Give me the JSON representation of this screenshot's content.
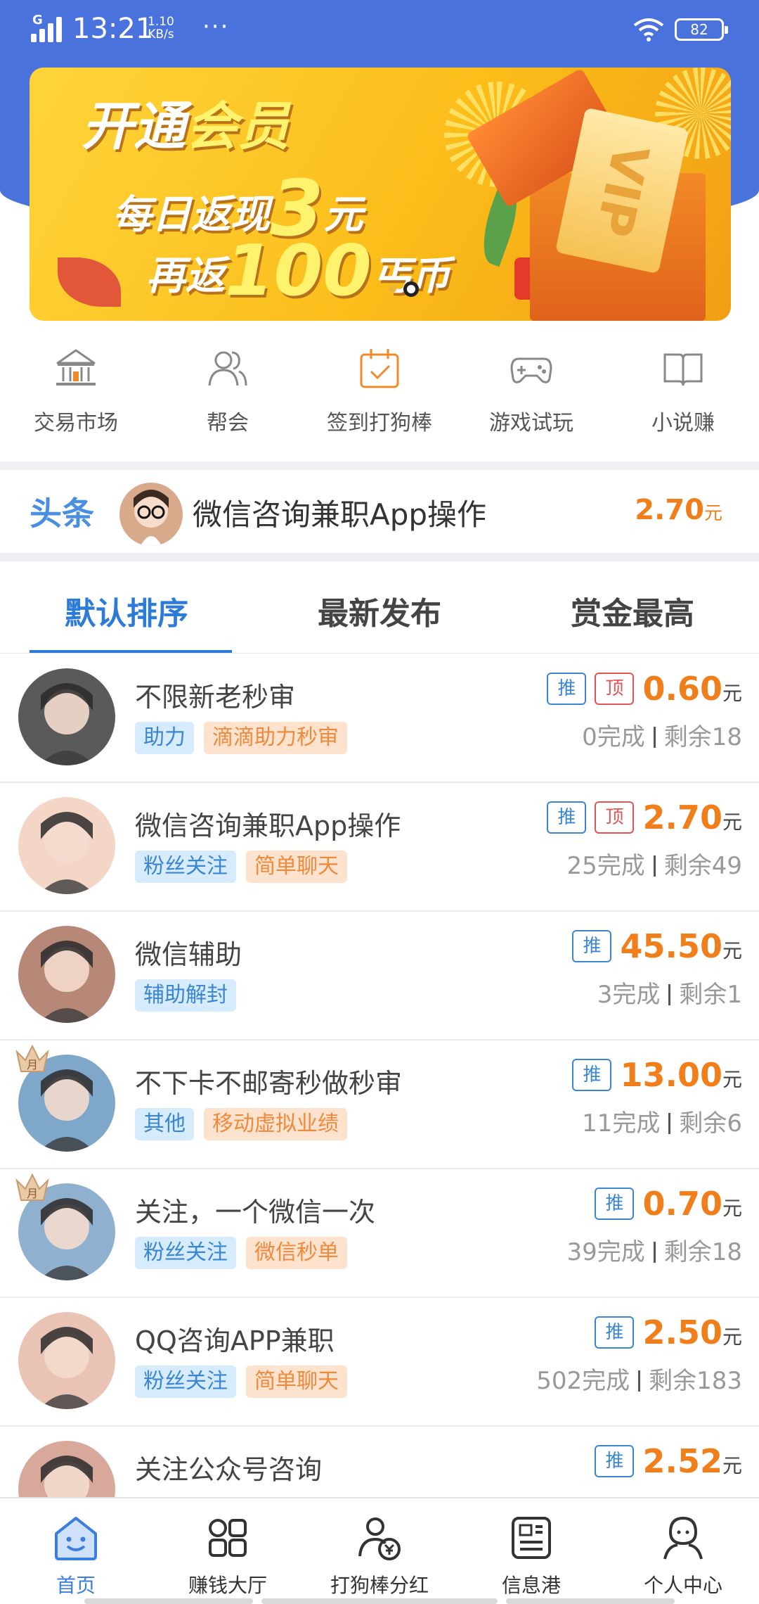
{
  "status_bar": {
    "network": "G",
    "time": "13:21",
    "speed_value": "1.10",
    "speed_unit": "KB/s",
    "more": "···",
    "battery": "82"
  },
  "banner": {
    "line1_a": "开通",
    "line1_b": "会员",
    "line2_a": "每日返现",
    "line2_b": "3",
    "line2_c": "元",
    "line3_a": "再返",
    "line3_b": "100",
    "line3_c": "丐币",
    "box_label": "VIP",
    "slide_count": 2,
    "active_slide": 2
  },
  "quick_nav": [
    {
      "label": "交易市场",
      "icon": "bank-icon"
    },
    {
      "label": "帮会",
      "icon": "people-icon"
    },
    {
      "label": "签到打狗棒",
      "icon": "calendar-check-icon"
    },
    {
      "label": "游戏试玩",
      "icon": "gamepad-icon"
    },
    {
      "label": "小说赚",
      "icon": "book-icon"
    }
  ],
  "headline": {
    "tag": "头条",
    "title": "微信咨询兼职App操作",
    "price": "2.70",
    "unit": "元"
  },
  "tabs": [
    {
      "label": "默认排序",
      "active": true
    },
    {
      "label": "最新发布",
      "active": false
    },
    {
      "label": "赏金最高",
      "active": false
    }
  ],
  "tasks": [
    {
      "title": "不限新老秒审",
      "tags": [
        "助力",
        "滴滴助力秒审"
      ],
      "badges": [
        "推",
        "顶"
      ],
      "price": "0.60",
      "unit": "元",
      "done": "0完成",
      "remain": "剩余18",
      "crown": false
    },
    {
      "title": "微信咨询兼职App操作",
      "tags": [
        "粉丝关注",
        "简单聊天"
      ],
      "badges": [
        "推",
        "顶"
      ],
      "price": "2.70",
      "unit": "元",
      "done": "25完成",
      "remain": "剩余49",
      "crown": false
    },
    {
      "title": "微信辅助",
      "tags": [
        "辅助解封"
      ],
      "badges": [
        "推"
      ],
      "price": "45.50",
      "unit": "元",
      "done": "3完成",
      "remain": "剩余1",
      "crown": false
    },
    {
      "title": "不下卡不邮寄秒做秒审",
      "tags": [
        "其他",
        "移动虚拟业绩"
      ],
      "badges": [
        "推"
      ],
      "price": "13.00",
      "unit": "元",
      "done": "11完成",
      "remain": "剩余6",
      "crown": true,
      "crown_text": "月"
    },
    {
      "title": "关注，一个微信一次",
      "tags": [
        "粉丝关注",
        "微信秒单"
      ],
      "badges": [
        "推"
      ],
      "price": "0.70",
      "unit": "元",
      "done": "39完成",
      "remain": "剩余18",
      "crown": true,
      "crown_text": "月"
    },
    {
      "title": "QQ咨询APP兼职",
      "tags": [
        "粉丝关注",
        "简单聊天"
      ],
      "badges": [
        "推"
      ],
      "price": "2.50",
      "unit": "元",
      "done": "502完成",
      "remain": "剩余183",
      "crown": false
    },
    {
      "title": "关注公众号咨询",
      "tags": [],
      "badges": [
        "推"
      ],
      "price": "2.52",
      "unit": "元",
      "done": "",
      "remain": "",
      "crown": false
    }
  ],
  "bottom_nav": [
    {
      "label": "首页",
      "icon": "home-smile-icon",
      "active": true
    },
    {
      "label": "赚钱大厅",
      "icon": "grid-icon",
      "active": false
    },
    {
      "label": "打狗棒分红",
      "icon": "coin-user-icon",
      "active": false
    },
    {
      "label": "信息港",
      "icon": "news-icon",
      "active": false
    },
    {
      "label": "个人中心",
      "icon": "user-icon",
      "active": false
    }
  ],
  "colors": {
    "header_blue": "#4a72dd",
    "accent_blue": "#2c7bd8",
    "price_orange": "#f07f1b"
  }
}
